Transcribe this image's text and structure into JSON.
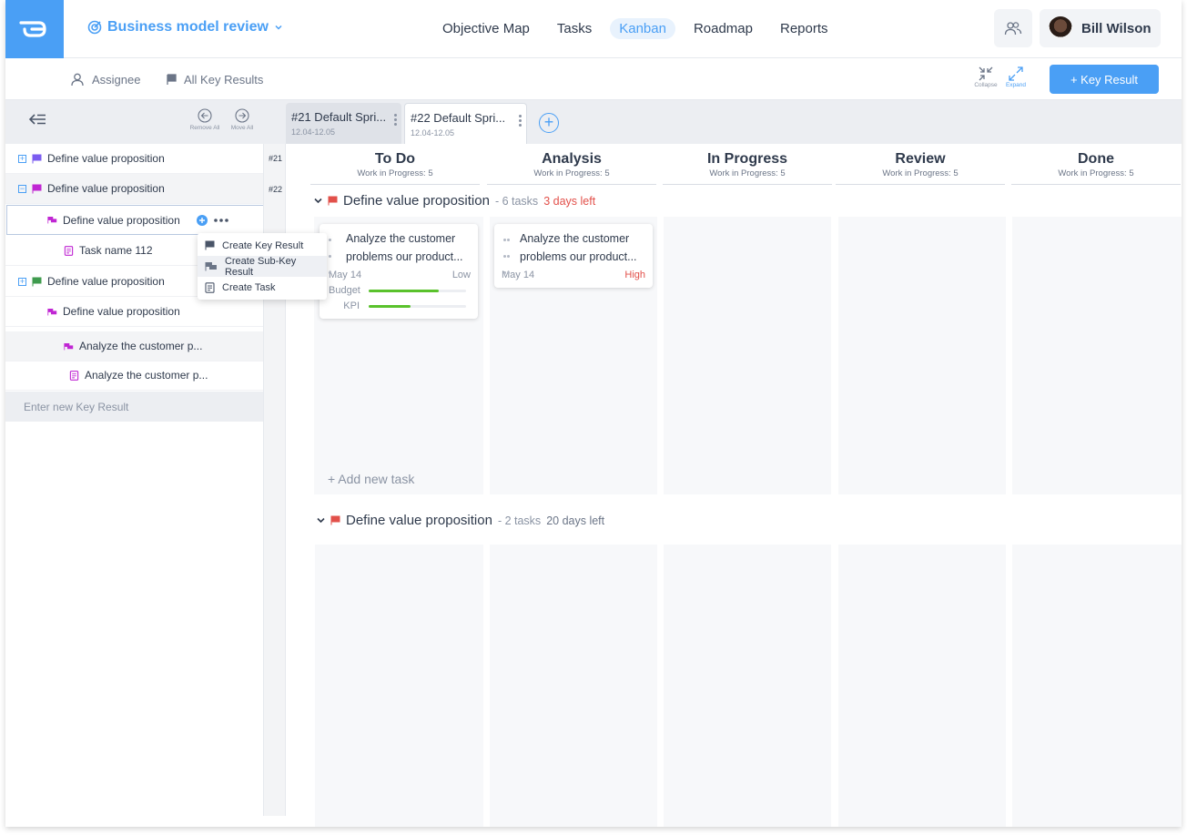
{
  "header": {
    "project_name": "Business model review",
    "nav": [
      "Objective Map",
      "Tasks",
      "Kanban",
      "Roadmap",
      "Reports"
    ],
    "active_nav": "Kanban",
    "user_name": "Bill Wilson",
    "brand_color": "#4a9ff5"
  },
  "subbar": {
    "assignee_filter": "Assignee",
    "kr_filter": "All Key Results",
    "collapse_label": "Collapse",
    "expand_label": "Expand",
    "add_kr_button": "+ Key Result"
  },
  "left_panel": {
    "remove_all": "Remove All",
    "move_all": "Move All",
    "rows": [
      {
        "label": "Define value proposition",
        "toggle": "+",
        "sprint": "#21",
        "color": "#7b5cf0"
      },
      {
        "label": "Define value proposition",
        "toggle": "−",
        "sprint": "#22",
        "color": "#c026d3"
      },
      {
        "label": "Define value proposition",
        "color": "#c026d3"
      },
      {
        "label": "Task name 112",
        "color": "#c026d3"
      },
      {
        "label": "Define value proposition",
        "toggle": "+",
        "color": "#3f9b4e"
      },
      {
        "label": "Define value proposition",
        "color": "#c026d3"
      },
      {
        "label": "Analyze the customer p...",
        "color": "#c026d3"
      },
      {
        "label": "Analyze the customer p...",
        "color": "#c026d3"
      }
    ],
    "enter_placeholder": "Enter new Key Result"
  },
  "context_menu": {
    "items": [
      "Create Key Result",
      "Create Sub-Key Result",
      "Create Task"
    ]
  },
  "sprints": [
    {
      "title": "#21  Default Spri...",
      "dates": "12.04-12.05"
    },
    {
      "title": "#22  Default Spri...",
      "dates": "12.04-12.05"
    }
  ],
  "columns": [
    {
      "title": "To Do",
      "wip": "Work in Progress: 5"
    },
    {
      "title": "Analysis",
      "wip": "Work in Progress: 5"
    },
    {
      "title": "In Progress",
      "wip": "Work in Progress: 5"
    },
    {
      "title": "Review",
      "wip": "Work in Progress: 5"
    },
    {
      "title": "Done",
      "wip": "Work in Progress: 5"
    }
  ],
  "swimlanes": [
    {
      "title": "Define value proposition",
      "count": "- 6 tasks",
      "due": "3 days left",
      "add_task": "+ Add new task",
      "cards": [
        {
          "title": "Analyze the customer problems our product...",
          "date": "May 14",
          "priority": "Low",
          "metrics": [
            {
              "label": "Budget",
              "progress": 0.72
            },
            {
              "label": "KPI",
              "progress": 0.43
            }
          ]
        },
        {
          "title": "Analyze the customer problems our product...",
          "date": "May 14",
          "priority": "High"
        }
      ]
    },
    {
      "title": "Define value proposition",
      "count": "- 2 tasks",
      "due": "20 days left"
    }
  ]
}
